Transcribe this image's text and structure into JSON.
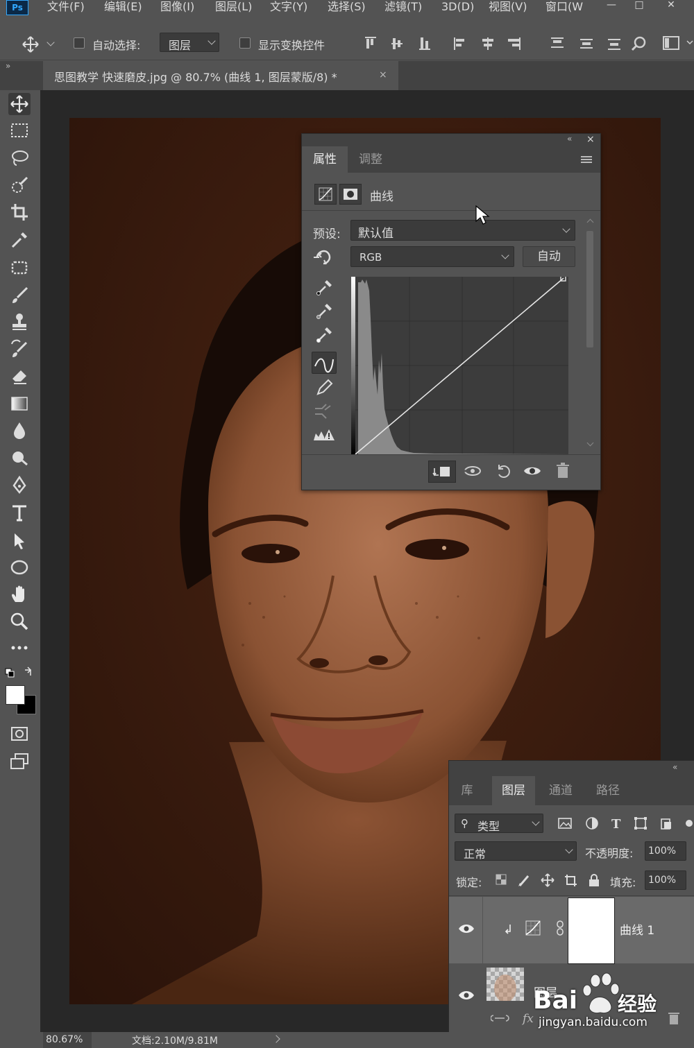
{
  "app": {
    "logo_text": "Ps"
  },
  "menu": [
    {
      "label": "文件(F)"
    },
    {
      "label": "编辑(E)"
    },
    {
      "label": "图像(I)"
    },
    {
      "label": "图层(L)"
    },
    {
      "label": "文字(Y)"
    },
    {
      "label": "选择(S)"
    },
    {
      "label": "滤镜(T)"
    },
    {
      "label": "3D(D)"
    },
    {
      "label": "视图(V)"
    },
    {
      "label": "窗口(W"
    }
  ],
  "options_bar": {
    "auto_select_label": "自动选择:",
    "auto_select_value": "图层",
    "show_transform_label": "显示变换控件",
    "auto_select_checked": false,
    "show_transform_checked": false
  },
  "document_tab": {
    "title": "思图教学 快速磨皮.jpg @ 80.7% (曲线 1, 图层蒙版/8) *",
    "close": "×"
  },
  "properties_panel": {
    "tabs": [
      {
        "label": "属性"
      },
      {
        "label": "调整"
      }
    ],
    "active_tab": "属性",
    "adjustment_name": "曲线",
    "preset_label": "预设:",
    "preset_value": "默认值",
    "channel_value": "RGB",
    "auto_button": "自动",
    "collapse_glyph": "«",
    "close_glyph": "×"
  },
  "layers_panel": {
    "tabs": [
      {
        "label": "库"
      },
      {
        "label": "图层"
      },
      {
        "label": "通道"
      },
      {
        "label": "路径"
      }
    ],
    "active_tab": "图层",
    "filter_value": "类型",
    "blend_mode": "正常",
    "opacity_label": "不透明度:",
    "opacity_value": "100%",
    "lock_label": "锁定:",
    "fill_label": "填充:",
    "fill_value": "100%",
    "layers": [
      {
        "name": "曲线 1",
        "visible": true,
        "type": "curves-adjustment"
      },
      {
        "name": "图层",
        "visible": true,
        "type": "pixel"
      }
    ]
  },
  "status_bar": {
    "zoom": "80.67%",
    "doc_info": "文档:2.10M/9.81M"
  },
  "watermark": {
    "brand": "Bai",
    "brand_suffix": "经验",
    "url": "jingyan.baidu.com"
  },
  "colors": {
    "ui_bg": "#535353",
    "panel_header": "#424242",
    "canvas_bg": "#282828",
    "ps_blue": "#31a8ff",
    "foreground": "#ffffff",
    "background": "#000000"
  }
}
